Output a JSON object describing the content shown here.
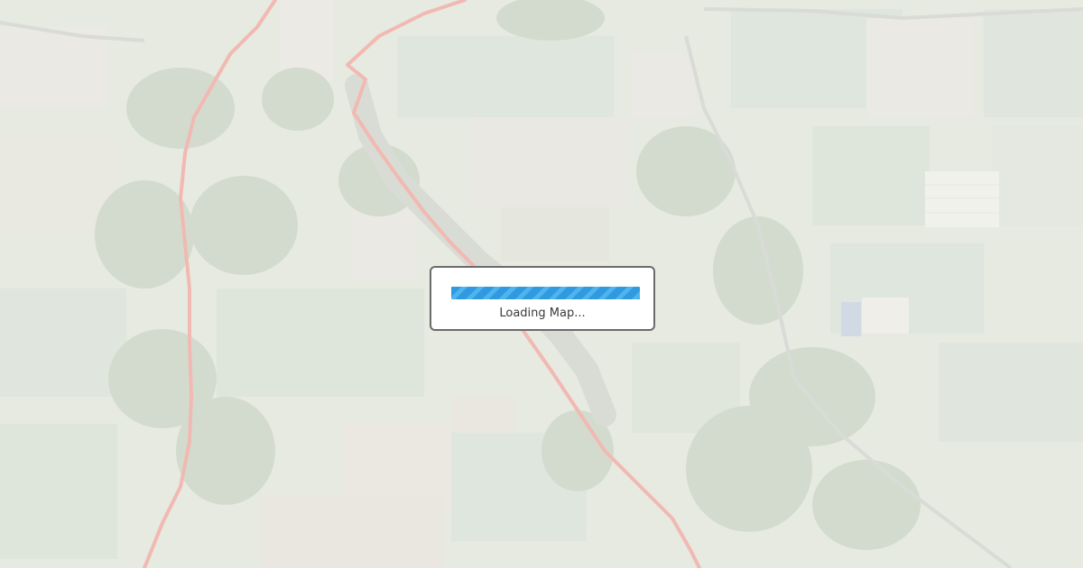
{
  "map": {
    "basemap": "satellite-imagery",
    "route_color": "#f28b82",
    "opacity_state": "faded"
  },
  "loading": {
    "text": "Loading Map...",
    "progress_fraction": 1.0,
    "bar_color": "#2f9ae0"
  }
}
